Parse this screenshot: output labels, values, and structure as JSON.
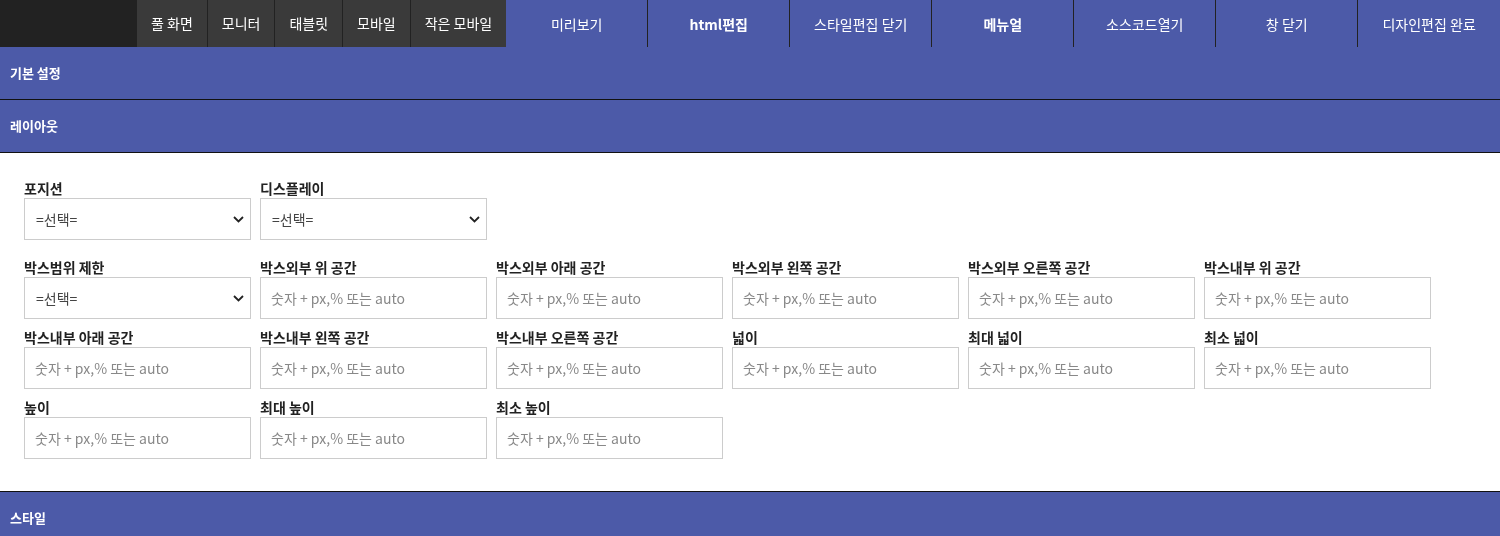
{
  "toolbar": {
    "devices": [
      {
        "label": "풀 화면"
      },
      {
        "label": "모니터"
      },
      {
        "label": "태블릿"
      },
      {
        "label": "모바일"
      },
      {
        "label": "작은 모바일"
      }
    ],
    "actions": [
      {
        "label": "미리보기",
        "bold": false
      },
      {
        "label": "html편집",
        "bold": true
      },
      {
        "label": "스타일편집 닫기",
        "bold": false
      },
      {
        "label": "메뉴얼",
        "bold": true
      },
      {
        "label": "소스코드열기",
        "bold": false
      },
      {
        "label": "창 닫기",
        "bold": false
      },
      {
        "label": "디자인편집 완료",
        "bold": false
      }
    ]
  },
  "sections": [
    {
      "title": "기본 설정"
    },
    {
      "title": "레이아웃",
      "fields": [
        {
          "label": "포지션",
          "kind": "select",
          "value": "=선택="
        },
        {
          "label": "디스플레이",
          "kind": "select",
          "value": "=선택="
        },
        {
          "kind": "break"
        },
        {
          "label": "박스범위 제한",
          "kind": "select",
          "value": "=선택="
        },
        {
          "label": "박스외부 위 공간",
          "kind": "text",
          "placeholder": "숫자 + px,% 또는 auto"
        },
        {
          "label": "박스외부 아래 공간",
          "kind": "text",
          "placeholder": "숫자 + px,% 또는 auto"
        },
        {
          "label": "박스외부 왼쪽 공간",
          "kind": "text",
          "placeholder": "숫자 + px,% 또는 auto"
        },
        {
          "label": "박스외부 오른쪽 공간",
          "kind": "text",
          "placeholder": "숫자 + px,% 또는 auto"
        },
        {
          "label": "박스내부 위 공간",
          "kind": "text",
          "placeholder": "숫자 + px,% 또는 auto"
        },
        {
          "label": "박스내부 아래 공간",
          "kind": "text",
          "placeholder": "숫자 + px,% 또는 auto"
        },
        {
          "label": "박스내부 왼쪽 공간",
          "kind": "text",
          "placeholder": "숫자 + px,% 또는 auto"
        },
        {
          "label": "박스내부 오른쪽 공간",
          "kind": "text",
          "placeholder": "숫자 + px,% 또는 auto"
        },
        {
          "label": "넓이",
          "kind": "text",
          "placeholder": "숫자 + px,% 또는 auto"
        },
        {
          "label": "최대 넓이",
          "kind": "text",
          "placeholder": "숫자 + px,% 또는 auto"
        },
        {
          "label": "최소 넓이",
          "kind": "text",
          "placeholder": "숫자 + px,% 또는 auto"
        },
        {
          "label": "높이",
          "kind": "text",
          "placeholder": "숫자 + px,% 또는 auto"
        },
        {
          "label": "최대 높이",
          "kind": "text",
          "placeholder": "숫자 + px,% 또는 auto"
        },
        {
          "label": "최소 높이",
          "kind": "text",
          "placeholder": "숫자 + px,% 또는 auto"
        }
      ]
    },
    {
      "title": "스타일"
    }
  ]
}
